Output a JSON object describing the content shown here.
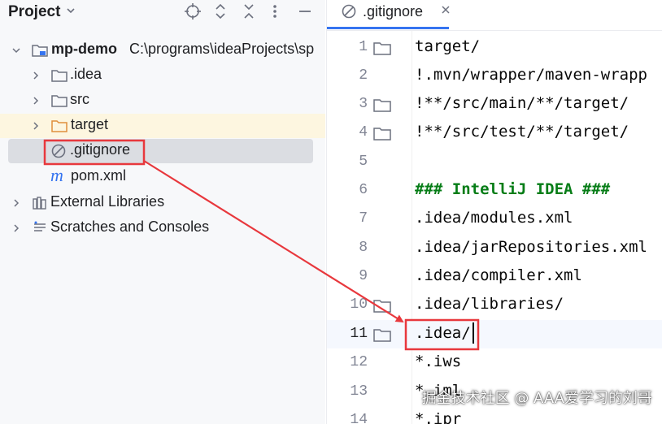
{
  "project_panel": {
    "title": "Project",
    "tree": {
      "mp_demo": {
        "name": "mp-demo",
        "path": "C:\\programs\\ideaProjects\\sp"
      },
      "idea": "idea",
      "idea_label": ".idea",
      "src": "src",
      "target": "target",
      "gitignore": ".gitignore",
      "pom": "pom.xml",
      "external_libraries": "External Libraries",
      "scratches": "Scratches and Consoles"
    }
  },
  "editor": {
    "tab": {
      "label": ".gitignore"
    },
    "lines": [
      {
        "no": "1",
        "text": "target/"
      },
      {
        "no": "2",
        "text": "!.mvn/wrapper/maven-wrapp"
      },
      {
        "no": "3",
        "text": "!**/src/main/**/target/"
      },
      {
        "no": "4",
        "text": "!**/src/test/**/target/"
      },
      {
        "no": "5",
        "text": ""
      },
      {
        "no": "6",
        "text": "### IntelliJ IDEA ###"
      },
      {
        "no": "7",
        "text": ".idea/modules.xml"
      },
      {
        "no": "8",
        "text": ".idea/jarRepositories.xml"
      },
      {
        "no": "9",
        "text": ".idea/compiler.xml"
      },
      {
        "no": "10",
        "text": ".idea/libraries/"
      },
      {
        "no": "11",
        "text": ".idea/"
      },
      {
        "no": "12",
        "text": "*.iws"
      },
      {
        "no": "13",
        "text": "*.iml"
      },
      {
        "no": "14",
        "text": "*.ipr"
      }
    ]
  },
  "watermark": "掘金技术社区 @ AAA爱学习的刘哥",
  "colors": {
    "panel_bg": "#f7f8fa",
    "selection_bg": "#dbdde2",
    "excluded_bg": "#fdf6e0",
    "folder_orange": "#e08f3c",
    "comment_green": "#067d17",
    "tab_accent": "#3574f0",
    "annotation_red": "#e8383d"
  }
}
